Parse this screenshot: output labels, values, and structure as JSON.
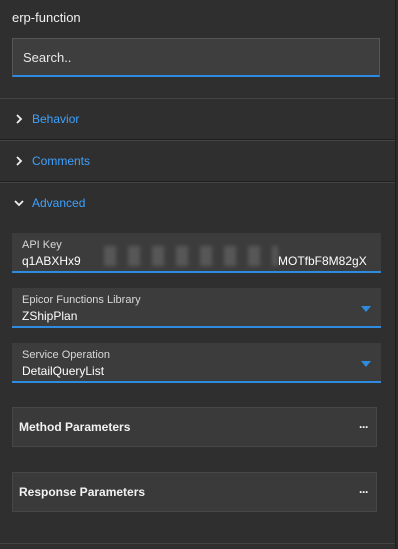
{
  "panel": {
    "title": "erp-function"
  },
  "search": {
    "placeholder": "Search.."
  },
  "sections": {
    "behavior": "Behavior",
    "comments": "Comments",
    "advanced": "Advanced"
  },
  "fields": {
    "api_key": {
      "label": "API Key",
      "value_start": "q1ABXHx9",
      "value_end": "MOTfbF8M82gX"
    },
    "functions_library": {
      "label": "Epicor Functions Library",
      "value": "ZShipPlan"
    },
    "service_operation": {
      "label": "Service Operation",
      "value": "DetailQueryList"
    }
  },
  "boxes": {
    "method_parameters": {
      "label": "Method Parameters",
      "more": "···"
    },
    "response_parameters": {
      "label": "Response Parameters",
      "more": "···"
    }
  },
  "colors": {
    "accent": "#2e8be0",
    "link": "#3ea2ff",
    "panel_bg": "#2f2f2f",
    "field_bg": "#3c3c3c"
  },
  "icons": {
    "collapsed": "chevron-right-icon",
    "expanded": "chevron-down-icon",
    "more": "ellipsis-icon"
  }
}
